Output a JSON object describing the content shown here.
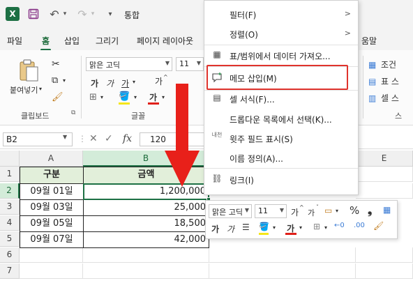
{
  "titlebar": {
    "app_logo": "X",
    "doc_title": "통합",
    "icons": [
      "excel-logo",
      "save-icon",
      "undo-icon",
      "redo-icon",
      "customize-qat-icon"
    ]
  },
  "tabs": [
    "파일",
    "홈",
    "삽입",
    "그리기",
    "페이지 레이아웃",
    "움말"
  ],
  "ribbon": {
    "paste_label": "붙여넣기",
    "clipboard_group": "클립보드",
    "font_group": "글꼴",
    "font_name": "맑은 고딕",
    "font_size": "11",
    "grow_font": "가",
    "shrink_font": "가",
    "bold": "가",
    "italic": "가",
    "underline": "가",
    "font_color_letter": "가",
    "cond_format": "조건",
    "table_format": "표 스",
    "cell_styles": "셀 스",
    "styles_group": "스"
  },
  "formula_bar": {
    "name_box": "B2",
    "cancel": "✕",
    "enter": "✓",
    "fx": "fx",
    "value": "120"
  },
  "grid": {
    "columns": [
      "A",
      "B",
      "E"
    ],
    "rows": [
      "1",
      "2",
      "3",
      "4",
      "5",
      "6",
      "7"
    ],
    "header": [
      "구분",
      "금액"
    ],
    "data": [
      [
        "09월 01일",
        "1,200,000"
      ],
      [
        "09월 03일",
        "25,000"
      ],
      [
        "09월 05일",
        "18,500"
      ],
      [
        "09월 07일",
        "42,000"
      ]
    ]
  },
  "context_menu": {
    "items": [
      {
        "label": "필터(F)",
        "icon": "",
        "submenu": true
      },
      {
        "label": "정렬(O)",
        "icon": "",
        "submenu": true
      },
      {
        "label": "표/범위에서 데이터 가져오...",
        "icon": "table-icon",
        "submenu": false
      },
      {
        "label": "메모 삽입(M)",
        "icon": "new-comment-icon",
        "submenu": false
      },
      {
        "label": "셀 서식(F)...",
        "icon": "format-cells-icon",
        "submenu": false
      },
      {
        "label": "드롭다운 목록에서 선택(K)...",
        "icon": "",
        "submenu": false
      },
      {
        "label": "윗주 필드 표시(S)",
        "icon": "phonetic-icon",
        "submenu": false
      },
      {
        "label": "이름 정의(A)...",
        "icon": "",
        "submenu": false
      },
      {
        "label": "링크(I)",
        "icon": "link-icon",
        "submenu": false
      }
    ],
    "phonetic_icon_text": "내천"
  },
  "mini_toolbar": {
    "font_name": "맑은 고딕",
    "font_size": "11",
    "grow": "가",
    "shrink": "가",
    "percent": "%",
    "comma": "❟",
    "bold": "가",
    "italic": "가",
    "font_color_letter": "가"
  },
  "colors": {
    "excel_green": "#1d7044",
    "header_fill": "#e2efda",
    "highlight_red": "#e0332d",
    "arrow_red": "#e8201a"
  }
}
